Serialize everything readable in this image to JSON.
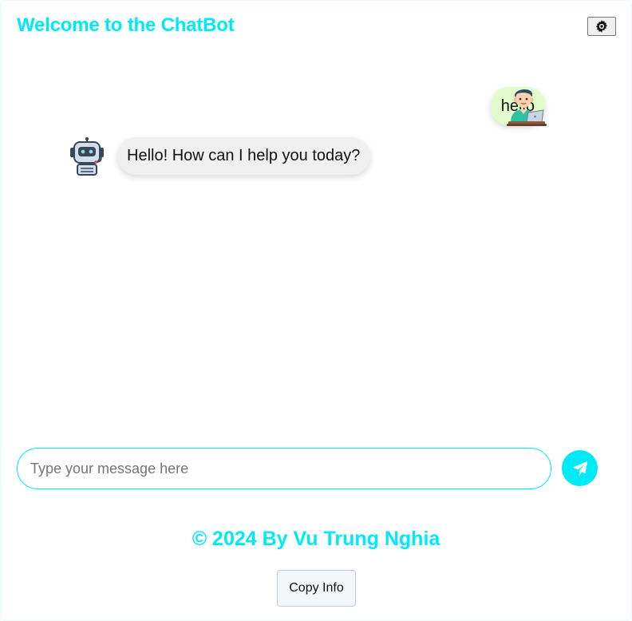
{
  "header": {
    "title": "Welcome to the ChatBot",
    "theme_toggle_icon": "gear-icon"
  },
  "messages": [
    {
      "sender": "user",
      "text": "hello",
      "avatar": "user-avatar-icon"
    },
    {
      "sender": "bot",
      "text": "Hello! How can I help you today?",
      "avatar": "robot-avatar-icon"
    }
  ],
  "composer": {
    "placeholder": "Type your message here",
    "value": "",
    "send_icon": "send-icon"
  },
  "footer": {
    "credit": "© 2024 By Vu Trung Nghia",
    "copy_button_label": "Copy Info"
  },
  "colors": {
    "accent": "#00eaf5",
    "user_bubble": "#e2fccb",
    "bot_bubble": "#f0f0f0"
  }
}
